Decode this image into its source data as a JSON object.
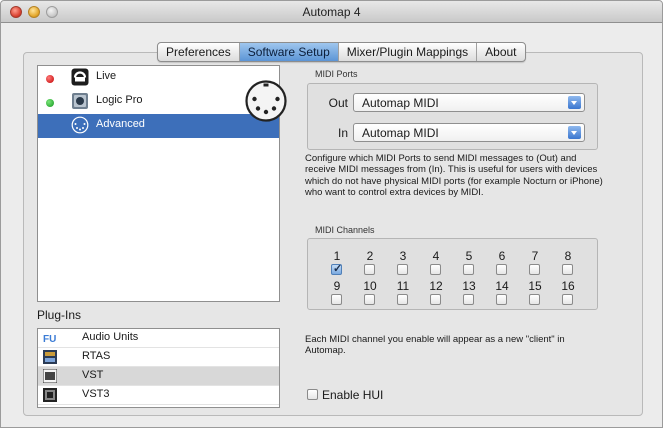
{
  "window": {
    "title": "Automap 4"
  },
  "tabs": [
    {
      "label": "Preferences"
    },
    {
      "label": "Software Setup",
      "active": true
    },
    {
      "label": "Mixer/Plugin Mappings"
    },
    {
      "label": "About"
    }
  ],
  "applications": [
    {
      "label": "Live",
      "status": "red",
      "icon": "ableton-live-icon"
    },
    {
      "label": "Logic Pro",
      "status": "green",
      "icon": "logic-pro-icon"
    },
    {
      "label": "Advanced",
      "status": "",
      "icon": "midi-port-icon",
      "selected": true
    }
  ],
  "plugins": {
    "label": "Plug-Ins",
    "items": [
      {
        "label": "Audio Units",
        "icon": "audio-units-icon"
      },
      {
        "label": "RTAS",
        "icon": "rtas-icon"
      },
      {
        "label": "VST",
        "icon": "vst-icon",
        "shaded": true
      },
      {
        "label": "VST3",
        "icon": "vst3-icon"
      }
    ]
  },
  "midi_ports": {
    "label": "MIDI Ports",
    "out_label": "Out",
    "out_value": "Automap MIDI",
    "in_label": "In",
    "in_value": "Automap MIDI"
  },
  "description": "Configure which MIDI Ports to send MIDI messages to (Out) and receive MIDI messages from (In). This is useful for users with devices which do not have physical MIDI ports (for example Nocturn or iPhone) who want to control extra devices by MIDI.",
  "midi_channels": {
    "label": "MIDI Channels",
    "channels": [
      {
        "num": "1",
        "checked": true
      },
      {
        "num": "2",
        "checked": false
      },
      {
        "num": "3",
        "checked": false
      },
      {
        "num": "4",
        "checked": false
      },
      {
        "num": "5",
        "checked": false
      },
      {
        "num": "6",
        "checked": false
      },
      {
        "num": "7",
        "checked": false
      },
      {
        "num": "8",
        "checked": false
      },
      {
        "num": "9",
        "checked": false
      },
      {
        "num": "10",
        "checked": false
      },
      {
        "num": "11",
        "checked": false
      },
      {
        "num": "12",
        "checked": false
      },
      {
        "num": "13",
        "checked": false
      },
      {
        "num": "14",
        "checked": false
      },
      {
        "num": "15",
        "checked": false
      },
      {
        "num": "16",
        "checked": false
      }
    ]
  },
  "client_note": "Each MIDI channel you enable will appear as a new \"client\" in Automap.",
  "hui": {
    "label": "Enable HUI",
    "checked": false
  },
  "colors": {
    "selection": "#3d6fba",
    "tab_active": "#5c95d6",
    "status_red": "#c20000",
    "status_green": "#14961e"
  }
}
